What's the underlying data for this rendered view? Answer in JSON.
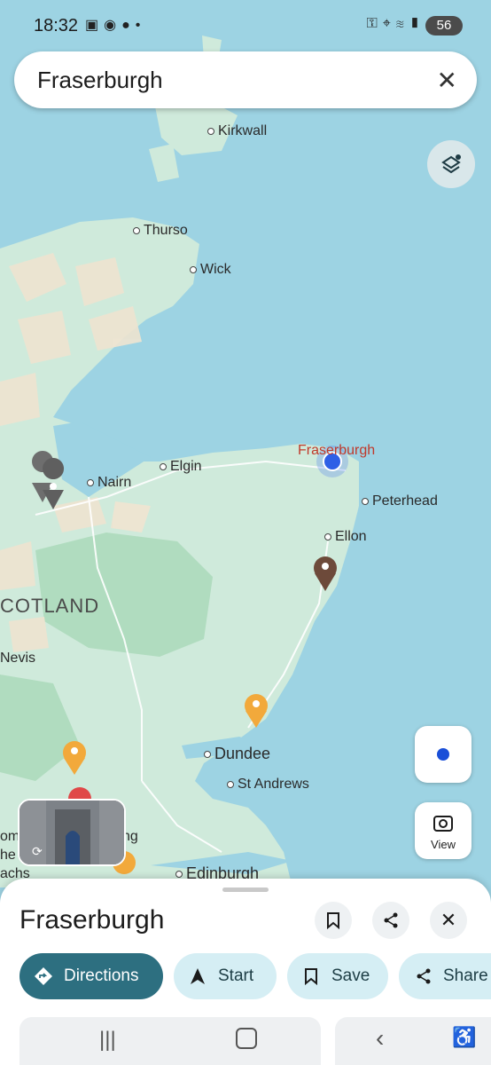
{
  "status_bar": {
    "time": "18:32",
    "left_icons": [
      "screenshot-icon",
      "accessibility-icon",
      "am-icon",
      "dot"
    ],
    "right_icons": [
      "key-icon",
      "location-icon",
      "wifi-icon",
      "signal-icon"
    ],
    "battery": "56"
  },
  "search": {
    "query": "Fraserburgh"
  },
  "map": {
    "region_label": "COTLAND",
    "places": [
      {
        "name": "Kirkwall"
      },
      {
        "name": "Thurso"
      },
      {
        "name": "Wick"
      },
      {
        "name": "Elgin"
      },
      {
        "name": "Nairn"
      },
      {
        "name": "Fraserburgh"
      },
      {
        "name": "Peterhead"
      },
      {
        "name": "Ellon"
      },
      {
        "name": "Nevis"
      },
      {
        "name": "Dundee"
      },
      {
        "name": "St Andrews"
      },
      {
        "name": "Edinburgh"
      }
    ],
    "edge_fragments": [
      "om",
      "he",
      "achs",
      "ng"
    ]
  },
  "controls": {
    "view_label": "View"
  },
  "sheet": {
    "title": "Fraserburgh",
    "actions": [
      {
        "label": "Directions",
        "icon": "directions-icon"
      },
      {
        "label": "Start",
        "icon": "navigation-arrow-icon"
      },
      {
        "label": "Save",
        "icon": "bookmark-icon"
      },
      {
        "label": "Share",
        "icon": "share-icon"
      }
    ]
  },
  "colors": {
    "sea": "#9dd3e3",
    "land": "#cfeadb",
    "primary_chip": "#2d6f80",
    "secondary_chip": "#d5eef4",
    "accent_label": "#c0392b"
  }
}
